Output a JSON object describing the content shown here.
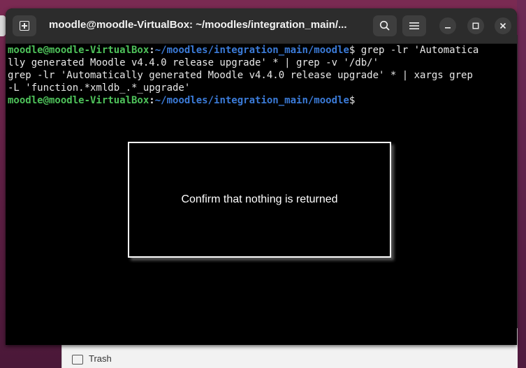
{
  "window": {
    "title": "moodle@moodle-VirtualBox: ~/moodles/integration_main/..."
  },
  "terminal": {
    "lines": [
      {
        "user": "moodle@moodle-VirtualBox",
        "colon": ":",
        "path": "~/moodles/integration_main/moodle",
        "cmd": "$ grep -lr 'Automatica"
      },
      {
        "text": "lly generated Moodle v4.4.0 release upgrade' * | grep -v '/db/'"
      },
      {
        "text": "grep -lr 'Automatically generated Moodle v4.4.0 release upgrade' * | xargs grep"
      },
      {
        "text": "-L 'function.*xmldb_.*_upgrade'"
      },
      {
        "user": "moodle@moodle-VirtualBox",
        "colon": ":",
        "path": "~/moodles/integration_main/moodle",
        "cmd": "$"
      }
    ]
  },
  "overlay": {
    "text": "Confirm that nothing is returned"
  },
  "files_panel": {
    "items": [
      "Trash"
    ]
  },
  "icons": {
    "new_tab": "new-tab-icon",
    "search": "search-icon",
    "menu": "hamburger-menu-icon",
    "minimize": "minimize-icon",
    "maximize": "maximize-icon",
    "close": "close-icon"
  }
}
